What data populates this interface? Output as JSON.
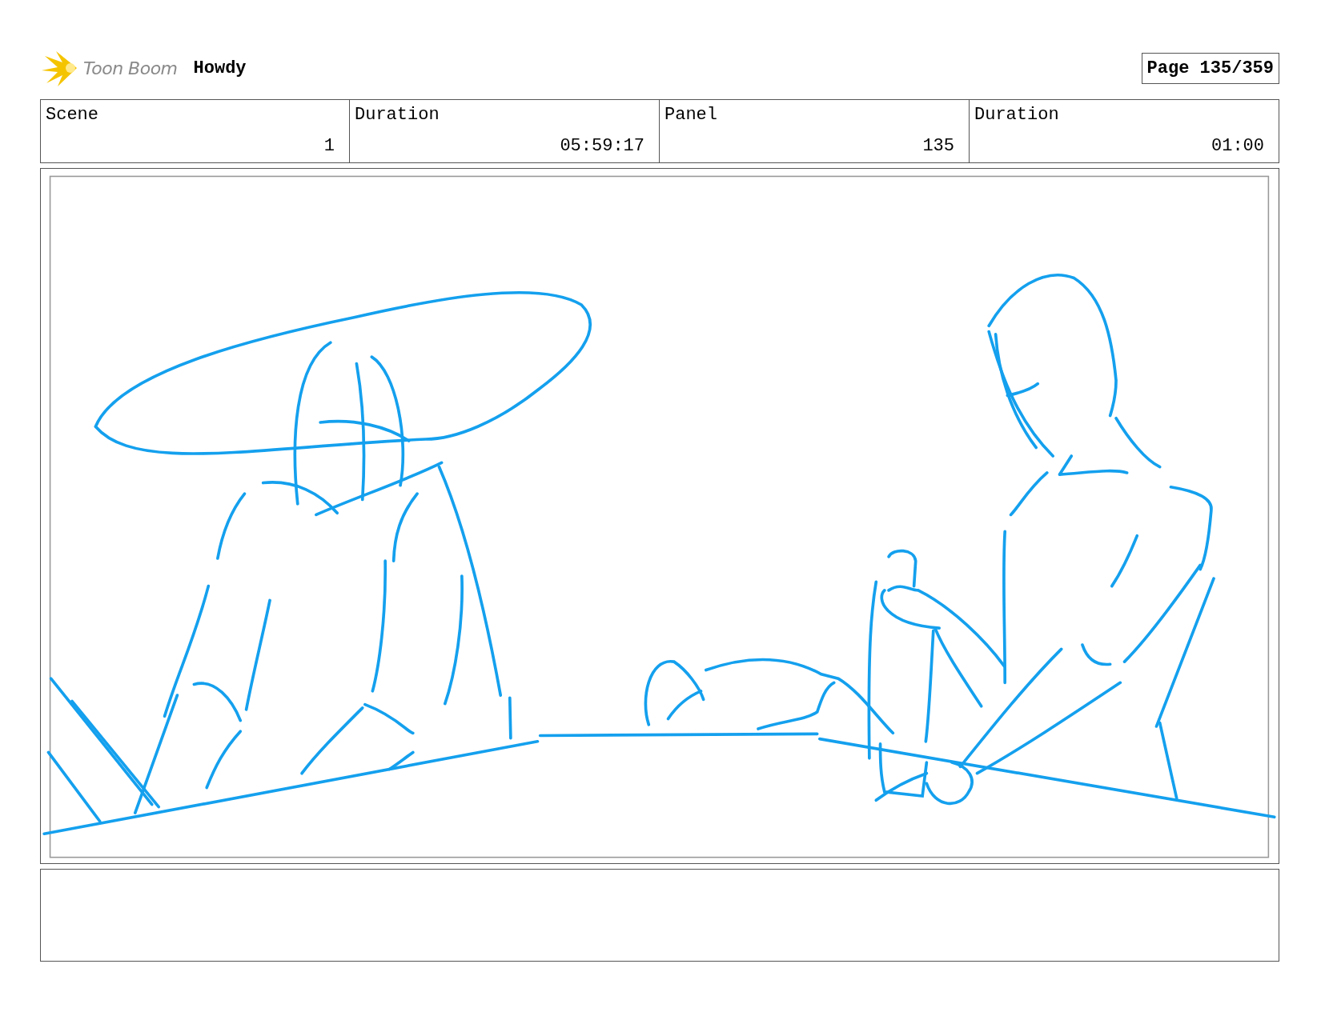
{
  "header": {
    "logo_text": "Toon Boom",
    "project_title": "Howdy",
    "page": "Page 135/359"
  },
  "fields": [
    {
      "label": "Scene",
      "value": "1"
    },
    {
      "label": "Duration",
      "value": "05:59:17"
    },
    {
      "label": "Panel",
      "value": "135"
    },
    {
      "label": "Duration",
      "value": "01:00"
    }
  ]
}
